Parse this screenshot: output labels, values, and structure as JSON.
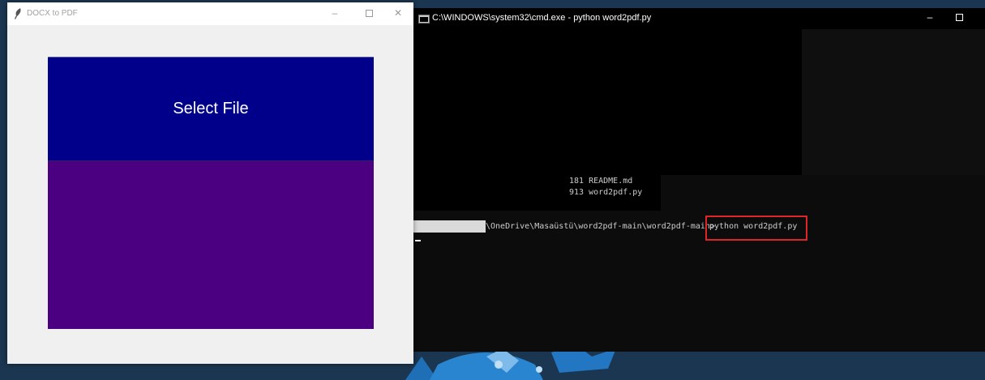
{
  "tk_window": {
    "title": "DOCX to PDF",
    "icon": "feather-icon",
    "minimize": "–",
    "close": "✕",
    "select_button_label": "Select File",
    "colors": {
      "button_bg": "#00008b",
      "drop_area_bg": "#4b0082",
      "window_bg": "#f0f0f0"
    }
  },
  "cmd_window": {
    "title": "C:\\WINDOWS\\system32\\cmd.exe - python  word2pdf.py",
    "minimize": "–",
    "output_lines": [
      "181 README.md",
      "913 word2pdf.py"
    ],
    "prompt_path": "\\OneDrive\\Masaüstü\\word2pdf-main\\word2pdf-main>",
    "command": "python word2pdf.py",
    "highlight_color": "#e0252a"
  }
}
